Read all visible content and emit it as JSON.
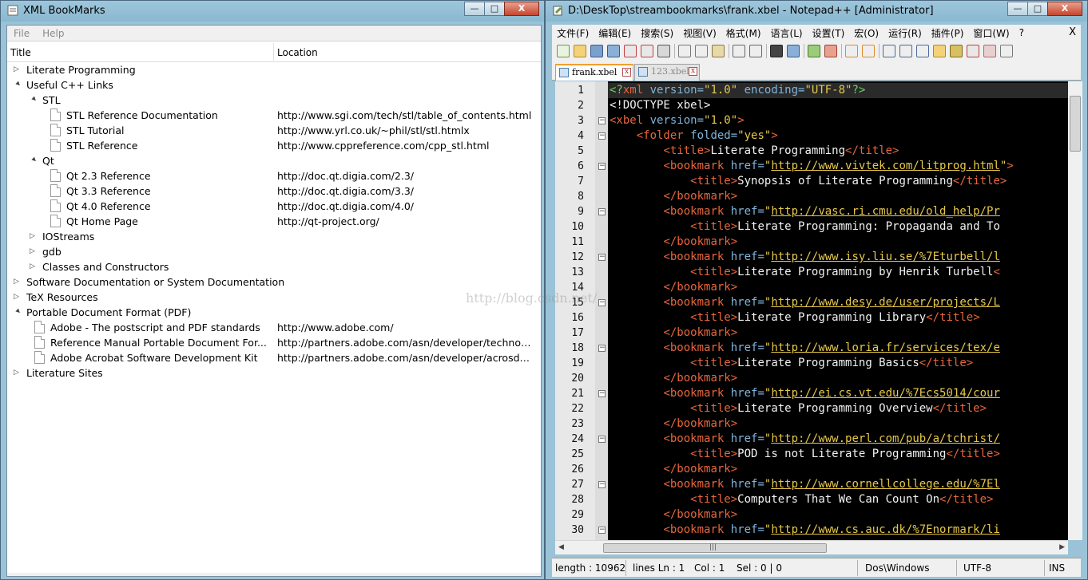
{
  "bookmarks_window": {
    "title": "XML BookMarks",
    "menu": [
      "File",
      "Help"
    ],
    "columns": [
      "Title",
      "Location"
    ],
    "rows": [
      {
        "indent": 0,
        "kind": "folder",
        "expanded": false,
        "title": "Literate Programming",
        "location": ""
      },
      {
        "indent": 0,
        "kind": "folder",
        "expanded": true,
        "title": "Useful C++ Links",
        "location": ""
      },
      {
        "indent": 1,
        "kind": "folder",
        "expanded": true,
        "title": "STL",
        "location": ""
      },
      {
        "indent": 2,
        "kind": "bookmark",
        "title": "STL Reference Documentation",
        "location": "http://www.sgi.com/tech/stl/table_of_contents.html"
      },
      {
        "indent": 2,
        "kind": "bookmark",
        "title": "STL Tutorial",
        "location": "http://www.yrl.co.uk/~phil/stl/stl.htmlx"
      },
      {
        "indent": 2,
        "kind": "bookmark",
        "title": "STL Reference",
        "location": "http://www.cppreference.com/cpp_stl.html"
      },
      {
        "indent": 1,
        "kind": "folder",
        "expanded": true,
        "title": "Qt",
        "location": ""
      },
      {
        "indent": 2,
        "kind": "bookmark",
        "title": "Qt 2.3 Reference",
        "location": "http://doc.qt.digia.com/2.3/"
      },
      {
        "indent": 2,
        "kind": "bookmark",
        "title": "Qt 3.3 Reference",
        "location": "http://doc.qt.digia.com/3.3/"
      },
      {
        "indent": 2,
        "kind": "bookmark",
        "title": "Qt 4.0 Reference",
        "location": "http://doc.qt.digia.com/4.0/"
      },
      {
        "indent": 2,
        "kind": "bookmark",
        "title": "Qt Home Page",
        "location": "http://qt-project.org/"
      },
      {
        "indent": 1,
        "kind": "folder",
        "expanded": false,
        "title": "IOStreams",
        "location": ""
      },
      {
        "indent": 1,
        "kind": "folder",
        "expanded": false,
        "title": "gdb",
        "location": ""
      },
      {
        "indent": 1,
        "kind": "folder",
        "expanded": false,
        "title": "Classes and Constructors",
        "location": ""
      },
      {
        "indent": 0,
        "kind": "folder",
        "expanded": false,
        "title": "Software Documentation or System Documentation",
        "location": ""
      },
      {
        "indent": 0,
        "kind": "folder",
        "expanded": false,
        "title": "TeX Resources",
        "location": ""
      },
      {
        "indent": 0,
        "kind": "folder",
        "expanded": true,
        "title": "Portable Document Format (PDF)",
        "location": ""
      },
      {
        "indent": 1,
        "kind": "bookmark",
        "title": "Adobe - The postscript and PDF standards",
        "location": "http://www.adobe.com/"
      },
      {
        "indent": 1,
        "kind": "bookmark",
        "title": "Reference Manual Portable Document For...",
        "location": "http://partners.adobe.com/asn/developer/technotes/..."
      },
      {
        "indent": 1,
        "kind": "bookmark",
        "title": "Adobe Acrobat Software Development Kit",
        "location": "http://partners.adobe.com/asn/developer/acrosdk/m..."
      },
      {
        "indent": 0,
        "kind": "folder",
        "expanded": false,
        "title": "Literature Sites",
        "location": ""
      }
    ]
  },
  "notepad_window": {
    "title": "D:\\DeskTop\\streambookmarks\\frank.xbel - Notepad++ [Administrator]",
    "menu": [
      "文件(F)",
      "编辑(E)",
      "搜索(S)",
      "视图(V)",
      "格式(M)",
      "语言(L)",
      "设置(T)",
      "宏(O)",
      "运行(R)",
      "插件(P)",
      "窗口(W)",
      "?"
    ],
    "menu_close": "X",
    "tabs": [
      {
        "label": "frank.xbel",
        "active": true
      },
      {
        "label": "123.xbel",
        "active": false
      }
    ],
    "lines": [
      {
        "n": "1",
        "fold": "",
        "segs": [
          [
            "pi",
            "<?"
          ],
          [
            "tag",
            "xml"
          ],
          [
            "attr",
            " version="
          ],
          [
            "val",
            "\"1.0\""
          ],
          [
            "attr",
            " encoding="
          ],
          [
            "val",
            "\"UTF-8\""
          ],
          [
            "pi",
            "?>"
          ]
        ]
      },
      {
        "n": "2",
        "fold": "",
        "segs": [
          [
            "doct",
            "<!DOCTYPE xbel>"
          ]
        ]
      },
      {
        "n": "3",
        "fold": "-",
        "segs": [
          [
            "tag",
            "<xbel"
          ],
          [
            "attr",
            " version="
          ],
          [
            "val",
            "\"1.0\""
          ],
          [
            "tag",
            ">"
          ]
        ]
      },
      {
        "n": "4",
        "fold": "-",
        "segs": [
          [
            "text",
            "    "
          ],
          [
            "tag",
            "<folder"
          ],
          [
            "attr",
            " folded="
          ],
          [
            "val",
            "\"yes\""
          ],
          [
            "tag",
            ">"
          ]
        ]
      },
      {
        "n": "5",
        "fold": "",
        "segs": [
          [
            "text",
            "        "
          ],
          [
            "tag",
            "<title>"
          ],
          [
            "text",
            "Literate Programming"
          ],
          [
            "tag",
            "</title>"
          ]
        ]
      },
      {
        "n": "6",
        "fold": "-",
        "segs": [
          [
            "text",
            "        "
          ],
          [
            "tag",
            "<bookmark"
          ],
          [
            "attr",
            " href="
          ],
          [
            "val",
            "\""
          ],
          [
            "url",
            "http://www.vivtek.com/litprog.html"
          ],
          [
            "val",
            "\""
          ],
          [
            "tag",
            ">"
          ]
        ]
      },
      {
        "n": "7",
        "fold": "",
        "segs": [
          [
            "text",
            "            "
          ],
          [
            "tag",
            "<title>"
          ],
          [
            "text",
            "Synopsis of Literate Programming"
          ],
          [
            "tag",
            "</title>"
          ]
        ]
      },
      {
        "n": "8",
        "fold": "",
        "segs": [
          [
            "text",
            "        "
          ],
          [
            "tag",
            "</bookmark>"
          ]
        ]
      },
      {
        "n": "9",
        "fold": "-",
        "segs": [
          [
            "text",
            "        "
          ],
          [
            "tag",
            "<bookmark"
          ],
          [
            "attr",
            " href="
          ],
          [
            "val",
            "\""
          ],
          [
            "url",
            "http://vasc.ri.cmu.edu/old_help/Pr"
          ]
        ]
      },
      {
        "n": "10",
        "fold": "",
        "segs": [
          [
            "text",
            "            "
          ],
          [
            "tag",
            "<title>"
          ],
          [
            "text",
            "Literate Programming: Propaganda and To"
          ]
        ]
      },
      {
        "n": "11",
        "fold": "",
        "segs": [
          [
            "text",
            "        "
          ],
          [
            "tag",
            "</bookmark>"
          ]
        ]
      },
      {
        "n": "12",
        "fold": "-",
        "segs": [
          [
            "text",
            "        "
          ],
          [
            "tag",
            "<bookmark"
          ],
          [
            "attr",
            " href="
          ],
          [
            "val",
            "\""
          ],
          [
            "url",
            "http://www.isy.liu.se/%7Eturbell/l"
          ]
        ]
      },
      {
        "n": "13",
        "fold": "",
        "segs": [
          [
            "text",
            "            "
          ],
          [
            "tag",
            "<title>"
          ],
          [
            "text",
            "Literate Programming by Henrik Turbell"
          ],
          [
            "tag",
            "<"
          ]
        ]
      },
      {
        "n": "14",
        "fold": "",
        "segs": [
          [
            "text",
            "        "
          ],
          [
            "tag",
            "</bookmark>"
          ]
        ]
      },
      {
        "n": "15",
        "fold": "-",
        "segs": [
          [
            "text",
            "        "
          ],
          [
            "tag",
            "<bookmark"
          ],
          [
            "attr",
            " href="
          ],
          [
            "val",
            "\""
          ],
          [
            "url",
            "http://www.desy.de/user/projects/L"
          ]
        ]
      },
      {
        "n": "16",
        "fold": "",
        "segs": [
          [
            "text",
            "            "
          ],
          [
            "tag",
            "<title>"
          ],
          [
            "text",
            "Literate Programming Library"
          ],
          [
            "tag",
            "</title>"
          ]
        ]
      },
      {
        "n": "17",
        "fold": "",
        "segs": [
          [
            "text",
            "        "
          ],
          [
            "tag",
            "</bookmark>"
          ]
        ]
      },
      {
        "n": "18",
        "fold": "-",
        "segs": [
          [
            "text",
            "        "
          ],
          [
            "tag",
            "<bookmark"
          ],
          [
            "attr",
            " href="
          ],
          [
            "val",
            "\""
          ],
          [
            "url",
            "http://www.loria.fr/services/tex/e"
          ]
        ]
      },
      {
        "n": "19",
        "fold": "",
        "segs": [
          [
            "text",
            "            "
          ],
          [
            "tag",
            "<title>"
          ],
          [
            "text",
            "Literate Programming Basics"
          ],
          [
            "tag",
            "</title>"
          ]
        ]
      },
      {
        "n": "20",
        "fold": "",
        "segs": [
          [
            "text",
            "        "
          ],
          [
            "tag",
            "</bookmark>"
          ]
        ]
      },
      {
        "n": "21",
        "fold": "-",
        "segs": [
          [
            "text",
            "        "
          ],
          [
            "tag",
            "<bookmark"
          ],
          [
            "attr",
            " href="
          ],
          [
            "val",
            "\""
          ],
          [
            "url",
            "http://ei.cs.vt.edu/%7Ecs5014/cour"
          ]
        ]
      },
      {
        "n": "22",
        "fold": "",
        "segs": [
          [
            "text",
            "            "
          ],
          [
            "tag",
            "<title>"
          ],
          [
            "text",
            "Literate Programming Overview"
          ],
          [
            "tag",
            "</title>"
          ]
        ]
      },
      {
        "n": "23",
        "fold": "",
        "segs": [
          [
            "text",
            "        "
          ],
          [
            "tag",
            "</bookmark>"
          ]
        ]
      },
      {
        "n": "24",
        "fold": "-",
        "segs": [
          [
            "text",
            "        "
          ],
          [
            "tag",
            "<bookmark"
          ],
          [
            "attr",
            " href="
          ],
          [
            "val",
            "\""
          ],
          [
            "url",
            "http://www.perl.com/pub/a/tchrist/"
          ]
        ]
      },
      {
        "n": "25",
        "fold": "",
        "segs": [
          [
            "text",
            "            "
          ],
          [
            "tag",
            "<title>"
          ],
          [
            "text",
            "POD is not Literate Programming"
          ],
          [
            "tag",
            "</title>"
          ]
        ]
      },
      {
        "n": "26",
        "fold": "",
        "segs": [
          [
            "text",
            "        "
          ],
          [
            "tag",
            "</bookmark>"
          ]
        ]
      },
      {
        "n": "27",
        "fold": "-",
        "segs": [
          [
            "text",
            "        "
          ],
          [
            "tag",
            "<bookmark"
          ],
          [
            "attr",
            " href="
          ],
          [
            "val",
            "\""
          ],
          [
            "url",
            "http://www.cornellcollege.edu/%7El"
          ]
        ]
      },
      {
        "n": "28",
        "fold": "",
        "segs": [
          [
            "text",
            "            "
          ],
          [
            "tag",
            "<title>"
          ],
          [
            "text",
            "Computers That We Can Count On"
          ],
          [
            "tag",
            "</title>"
          ]
        ]
      },
      {
        "n": "29",
        "fold": "",
        "segs": [
          [
            "text",
            "        "
          ],
          [
            "tag",
            "</bookmark>"
          ]
        ]
      },
      {
        "n": "30",
        "fold": "-",
        "segs": [
          [
            "text",
            "        "
          ],
          [
            "tag",
            "<bookmark"
          ],
          [
            "attr",
            " href="
          ],
          [
            "val",
            "\""
          ],
          [
            "url",
            "http://www.cs.auc.dk/%7Enormark/li"
          ]
        ]
      }
    ],
    "status": {
      "length": "length : 10962",
      "lines": "lines Ln : 1",
      "col": "Col : 1",
      "sel": "Sel : 0 | 0",
      "eol": "Dos\\Windows",
      "encoding": "UTF-8",
      "mode": "INS"
    },
    "hscroll_grip": "|||"
  },
  "watermark": "http://blog.csdn.net/",
  "window_buttons": {
    "minimize": "—",
    "maximize": "□",
    "close": "X"
  },
  "icons": {
    "expanded": "▲",
    "collapsed": "▷"
  }
}
